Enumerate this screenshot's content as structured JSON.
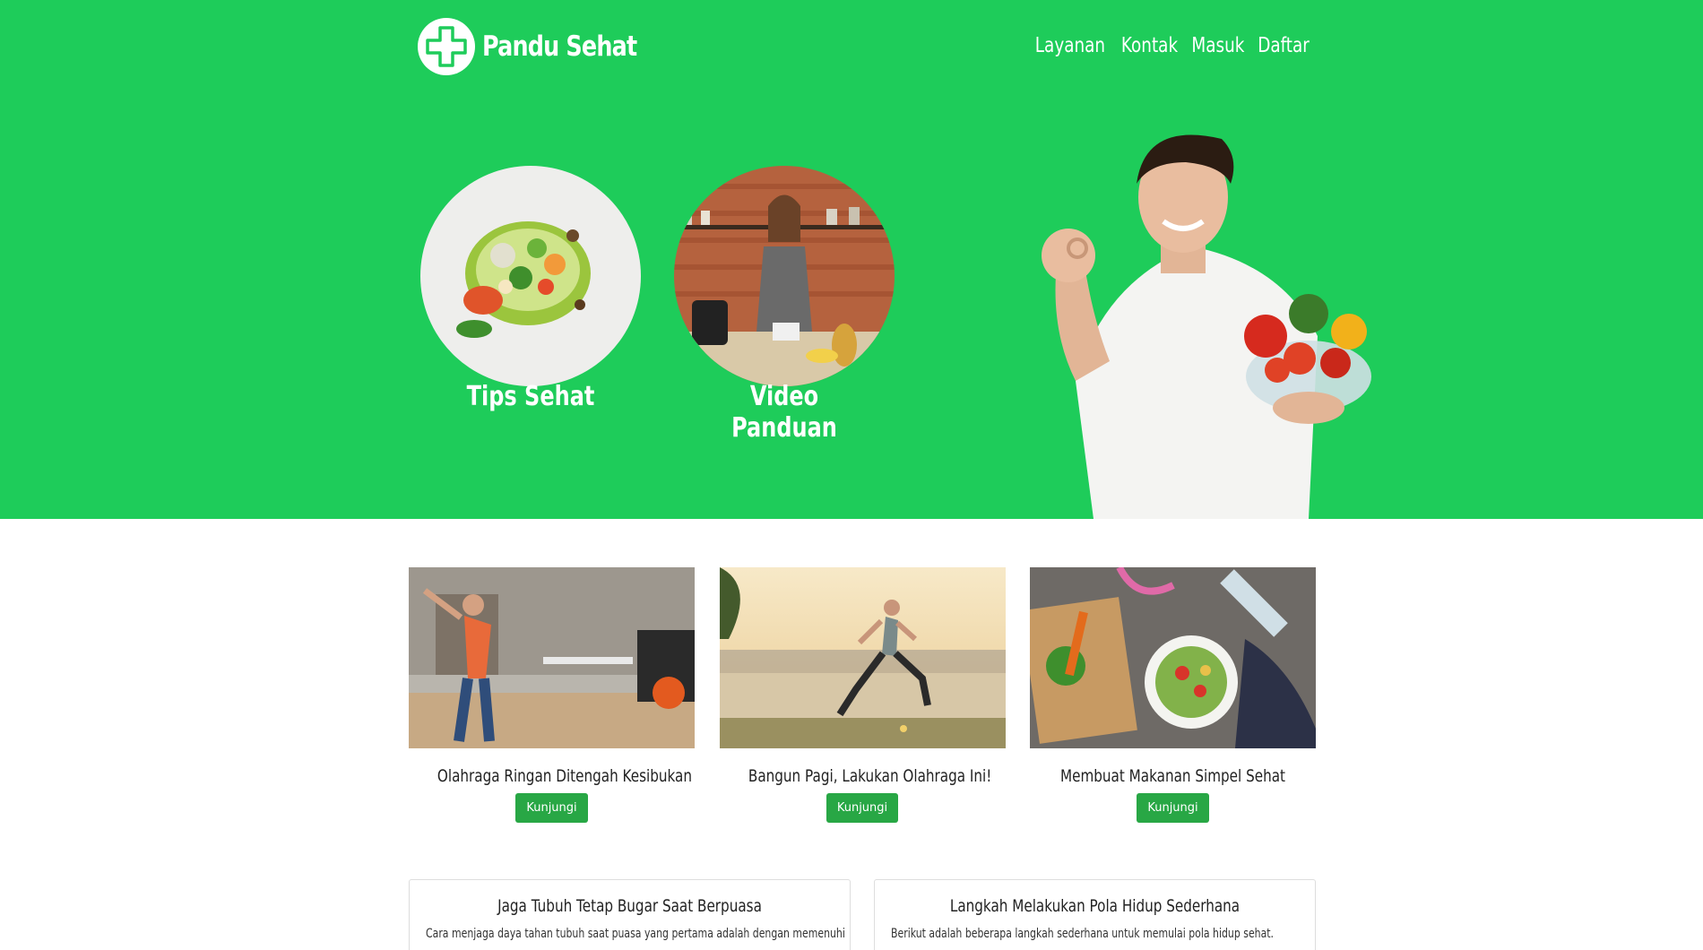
{
  "header": {
    "brand_name": "Pandu Sehat",
    "logo_icon": "medical-cross-icon",
    "nav": [
      {
        "label": "Layanan"
      },
      {
        "label": "Kontak"
      },
      {
        "label": "Masuk"
      },
      {
        "label": "Daftar"
      }
    ]
  },
  "hero": {
    "background_color": "#1ecc5a",
    "features": [
      {
        "label": "Tips Sehat",
        "image": "healthy-food-bowl-photo"
      },
      {
        "label": "Video Panduan",
        "image": "woman-drinking-smoothie-kitchen-photo"
      }
    ],
    "hero_image": "man-holding-vegetable-bowl-ok-sign-photo"
  },
  "cards": [
    {
      "title": "Olahraga Ringan Ditengah Kesibukan",
      "button": "Kunjungi",
      "image": "office-stretching-photo"
    },
    {
      "title": "Bangun Pagi, Lakukan Olahraga Ini!",
      "button": "Kunjungi",
      "image": "morning-run-riverside-photo"
    },
    {
      "title": "Membuat Makanan Simpel Sehat",
      "button": "Kunjungi",
      "image": "salad-and-fitness-gear-photo"
    }
  ],
  "articles": [
    {
      "title": "Jaga Tubuh Tetap Bugar Saat Berpuasa",
      "text": "Cara menjaga daya tahan tubuh saat puasa yang pertama adalah dengan memenuhi"
    },
    {
      "title": "Langkah Melakukan Pola Hidup Sederhana",
      "text": "Berikut adalah beberapa langkah sederhana untuk memulai pola hidup sehat."
    }
  ],
  "colors": {
    "accent": "#1ecc5a",
    "button": "#28a745"
  }
}
